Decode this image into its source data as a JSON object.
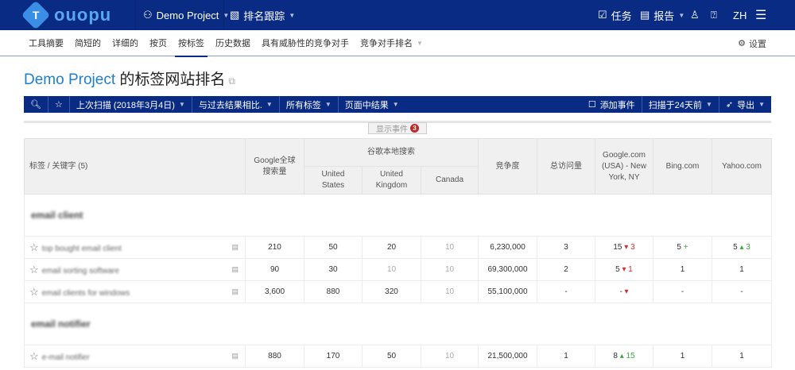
{
  "topbar": {
    "logo": "ouopu",
    "project": "Demo Project",
    "module": "排名跟踪",
    "tasks": "任务",
    "reports": "报告",
    "lang": "ZH"
  },
  "subnav": {
    "items": [
      "工具摘要",
      "简短的",
      "详细的",
      "按页",
      "按标签",
      "历史数据",
      "具有威胁性的竞争对手",
      "竞争对手排名"
    ],
    "active": 4,
    "settings": "设置"
  },
  "page": {
    "project": "Demo Project",
    "title_suffix": "的标签网站排名"
  },
  "toolbar": {
    "last_scan": "上次扫描 (2018年3月4日)",
    "compare": "与过去结果相比.",
    "all_tags": "所有标签",
    "page_results": "页面中结果",
    "add_event": "添加事件",
    "scanned": "扫描于24天前",
    "export": "导出"
  },
  "events": {
    "label": "显示事件",
    "count": "3"
  },
  "table": {
    "headers": {
      "keyword": "标签 / 关键字 (5)",
      "global_volume": "Google全球搜索量",
      "local_group": "谷歌本地搜索",
      "us": "United States",
      "uk": "United Kingdom",
      "ca": "Canada",
      "competition": "竞争度",
      "visits": "总访问量",
      "google_ny": "Google.com (USA) - New York, NY",
      "bing": "Bing.com",
      "yahoo": "Yahoo.com"
    },
    "groups": [
      {
        "name": "email client",
        "rows": [
          {
            "kw": "top bought email client",
            "vol": "210",
            "us": "50",
            "uk": "20",
            "ca": "10",
            "comp": "6,230,000",
            "visits": "3",
            "g": "15",
            "gchg": "3",
            "gdir": "down",
            "b": "5",
            "bchg": "+",
            "bdir": "up",
            "y": "5",
            "ychg": "3",
            "ydir": "up"
          },
          {
            "kw": "email sorting software",
            "vol": "90",
            "us": "30",
            "uk": "10",
            "ca": "10",
            "comp": "69,300,000",
            "visits": "2",
            "g": "5",
            "gchg": "1",
            "gdir": "down",
            "b": "1",
            "bchg": "",
            "bdir": "",
            "y": "1",
            "ychg": "",
            "ydir": ""
          },
          {
            "kw": "email clients for windows",
            "vol": "3,600",
            "us": "880",
            "uk": "320",
            "ca": "10",
            "comp": "55,100,000",
            "visits": "-",
            "g": "-",
            "gchg": "",
            "gdir": "down",
            "b": "-",
            "bchg": "",
            "bdir": "",
            "y": "-",
            "ychg": "",
            "ydir": ""
          }
        ]
      },
      {
        "name": "email notifier",
        "rows": [
          {
            "kw": "e-mail notifier",
            "vol": "880",
            "us": "170",
            "uk": "50",
            "ca": "10",
            "comp": "21,500,000",
            "visits": "1",
            "g": "8",
            "gchg": "15",
            "gdir": "up",
            "b": "1",
            "bchg": "",
            "bdir": "",
            "y": "1",
            "ychg": "",
            "ydir": ""
          }
        ]
      }
    ]
  }
}
